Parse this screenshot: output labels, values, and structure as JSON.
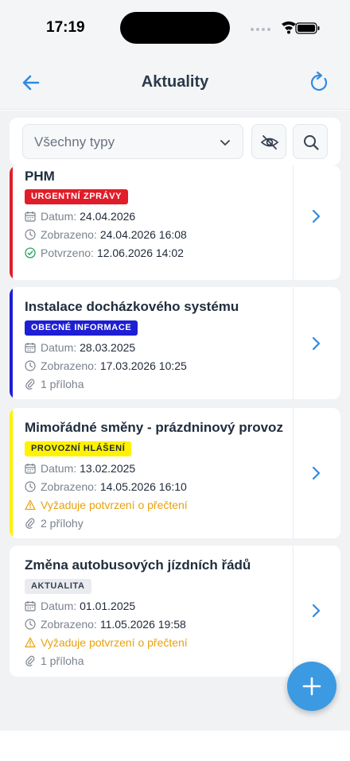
{
  "status_bar": {
    "time": "17:19"
  },
  "header": {
    "title": "Aktuality",
    "back_icon": "arrow-left-icon",
    "refresh_icon": "refresh-icon"
  },
  "filter": {
    "type_select_value": "Všechny typy",
    "hide_read_icon": "eye-off-icon",
    "search_icon": "search-icon"
  },
  "colors": {
    "accent": "#3b9ae1",
    "urgent": "#e11d2a",
    "general": "#1e1ed4",
    "operational": "#fff200",
    "update": "#9ca3af",
    "warning": "#e8a10b",
    "ok": "#22a65a"
  },
  "news": [
    {
      "title": "PHM",
      "badge": "URGENTNÍ ZPRÁVY",
      "datum_label": "Datum:",
      "datum": "24.04.2026",
      "zobrazeno_label": "Zobrazeno:",
      "zobrazeno": "24.04.2026 16:08",
      "potvrzeno_label": "Potvrzeno:",
      "potvrzeno": "12.06.2026 14:02"
    },
    {
      "title": "Instalace docházkového systému",
      "badge": "OBECNÉ INFORMACE",
      "datum_label": "Datum:",
      "datum": "28.03.2025",
      "zobrazeno_label": "Zobrazeno:",
      "zobrazeno": "17.03.2026 10:25",
      "attachments": "1 příloha"
    },
    {
      "title": "Mimořádné směny - prázdninový provoz",
      "badge": "PROVOZNÍ HLÁŠENÍ",
      "datum_label": "Datum:",
      "datum": "13.02.2025",
      "zobrazeno_label": "Zobrazeno:",
      "zobrazeno": "14.05.2026 16:10",
      "warning": "Vyžaduje potvrzení o přečtení",
      "attachments": "2 přílohy"
    },
    {
      "title": "Změna autobusových jízdních řádů",
      "badge": "AKTUALITA",
      "datum_label": "Datum:",
      "datum": "01.01.2025",
      "zobrazeno_label": "Zobrazeno:",
      "zobrazeno": "11.05.2026 19:58",
      "warning": "Vyžaduje potvrzení o přečtení",
      "attachments": "1 příloha"
    }
  ],
  "fab": {
    "icon": "plus-icon"
  }
}
